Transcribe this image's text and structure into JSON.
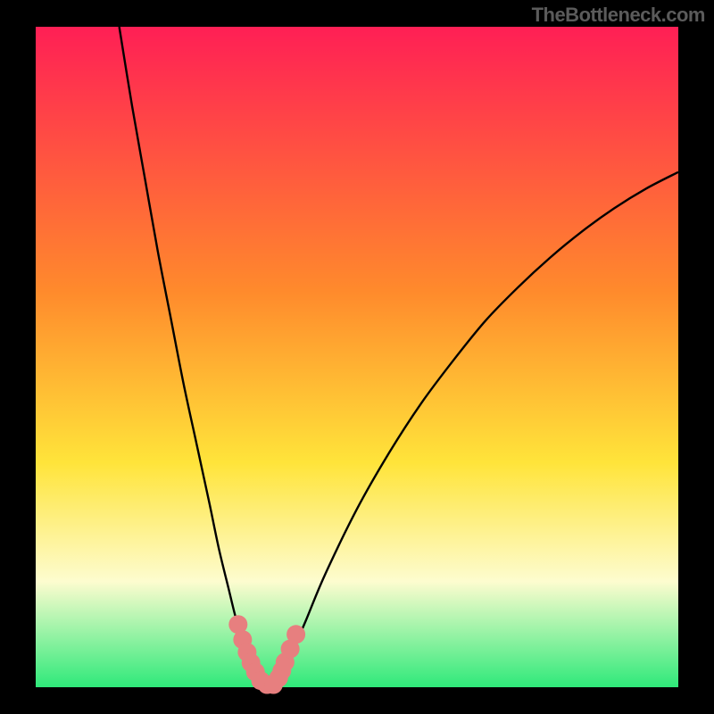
{
  "watermark": "TheBottleneck.com",
  "colors": {
    "page_bg": "#000000",
    "gradient_top": "#ff1f55",
    "gradient_mid1": "#ff8a2c",
    "gradient_mid2": "#ffe43a",
    "gradient_light": "#fdfccf",
    "gradient_bottom": "#2fe97a",
    "curve": "#000000",
    "marker_fill": "#e77f7f",
    "marker_stroke": "#d65f5f"
  },
  "chart_data": {
    "type": "line",
    "title": "",
    "xlabel": "",
    "ylabel": "",
    "xlim": [
      0,
      100
    ],
    "ylim": [
      0,
      100
    ],
    "series": [
      {
        "name": "left-branch",
        "x": [
          13,
          15,
          17,
          19,
          21,
          23,
          25,
          27,
          28.5,
          30,
          31,
          32,
          33,
          33.7,
          34.3,
          35
        ],
        "y": [
          100,
          88,
          77,
          66,
          56,
          46,
          37,
          28,
          21,
          15,
          11,
          7.5,
          4.5,
          2.6,
          1.2,
          0.2
        ]
      },
      {
        "name": "right-branch",
        "x": [
          37,
          38,
          39,
          40,
          42,
          45,
          50,
          55,
          60,
          65,
          70,
          75,
          80,
          85,
          90,
          95,
          100
        ],
        "y": [
          0.2,
          1.3,
          3.2,
          5.5,
          10,
          17,
          27,
          35.5,
          43,
          49.5,
          55.5,
          60.5,
          65,
          69,
          72.5,
          75.5,
          78
        ]
      }
    ],
    "markers": {
      "name": "highlight-points",
      "x": [
        31.5,
        32.2,
        32.9,
        33.5,
        34.2,
        35.0,
        36.0,
        37.0,
        37.8,
        38.3,
        38.8,
        39.6,
        40.5
      ],
      "y": [
        9.5,
        7.2,
        5.3,
        3.7,
        2.3,
        1.0,
        0.4,
        0.4,
        1.4,
        2.5,
        3.8,
        5.8,
        8.0
      ]
    }
  }
}
